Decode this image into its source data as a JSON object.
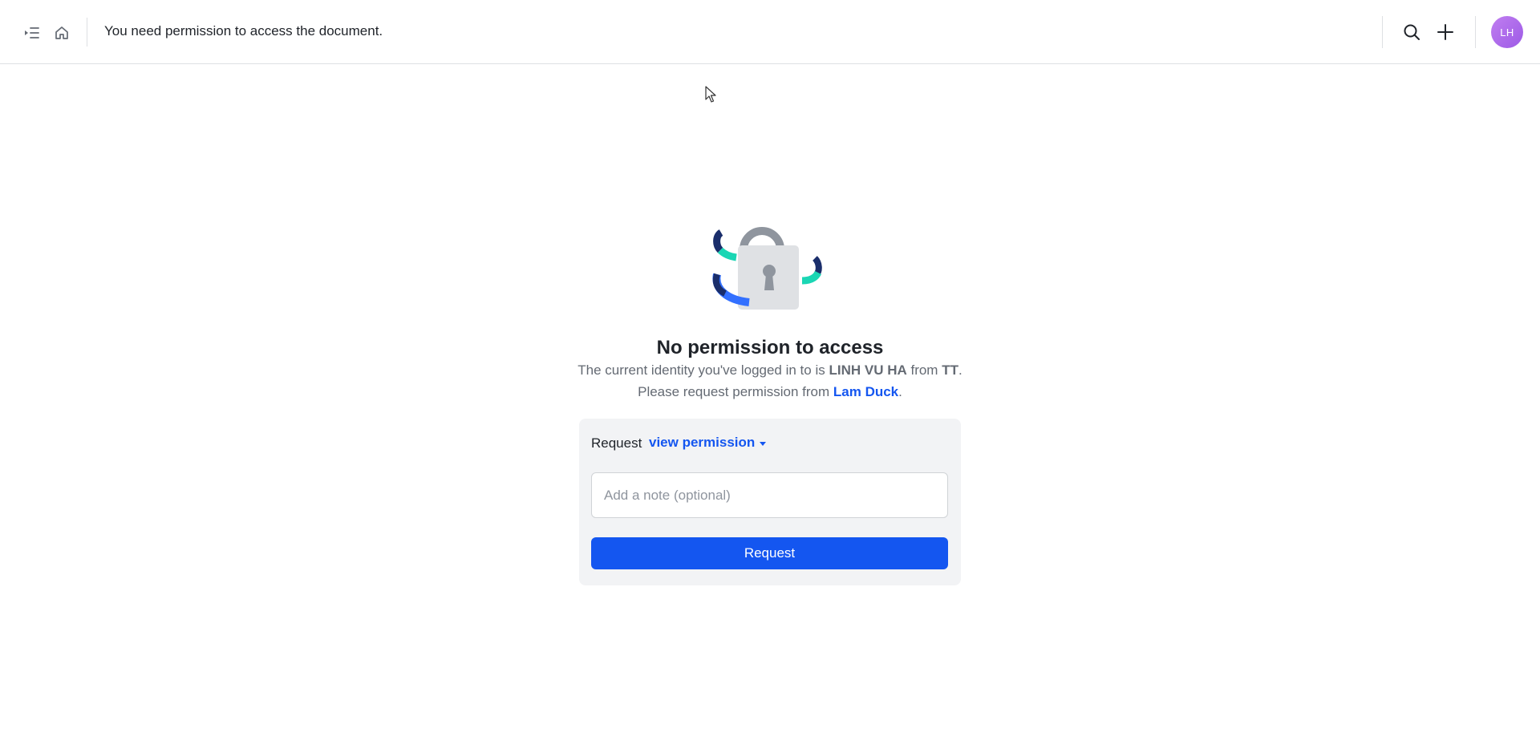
{
  "header": {
    "title": "You need permission to access the document.",
    "avatar_initials": "LH",
    "icons": [
      "sidebar-toggle-icon",
      "home-icon",
      "search-icon",
      "plus-icon"
    ]
  },
  "main": {
    "heading": "No permission to access",
    "description": {
      "part1": "The current identity you've logged in to is ",
      "user_name": "LINH VU HA",
      "part2": " from ",
      "org_name": "TT",
      "part3": ". Please request permission from ",
      "owner_name": "Lam Duck",
      "part4": "."
    },
    "request": {
      "label": "Request",
      "permission_value": "view permission",
      "note_placeholder": "Add a note (optional)",
      "note_value": "",
      "button_label": "Request"
    }
  },
  "colors": {
    "accent": "#1456f0",
    "avatar_start": "#c07ef0",
    "avatar_end": "#9d5ae6",
    "illustration_teal": "#1ad6b4",
    "illustration_navy": "#1a2e6b"
  }
}
